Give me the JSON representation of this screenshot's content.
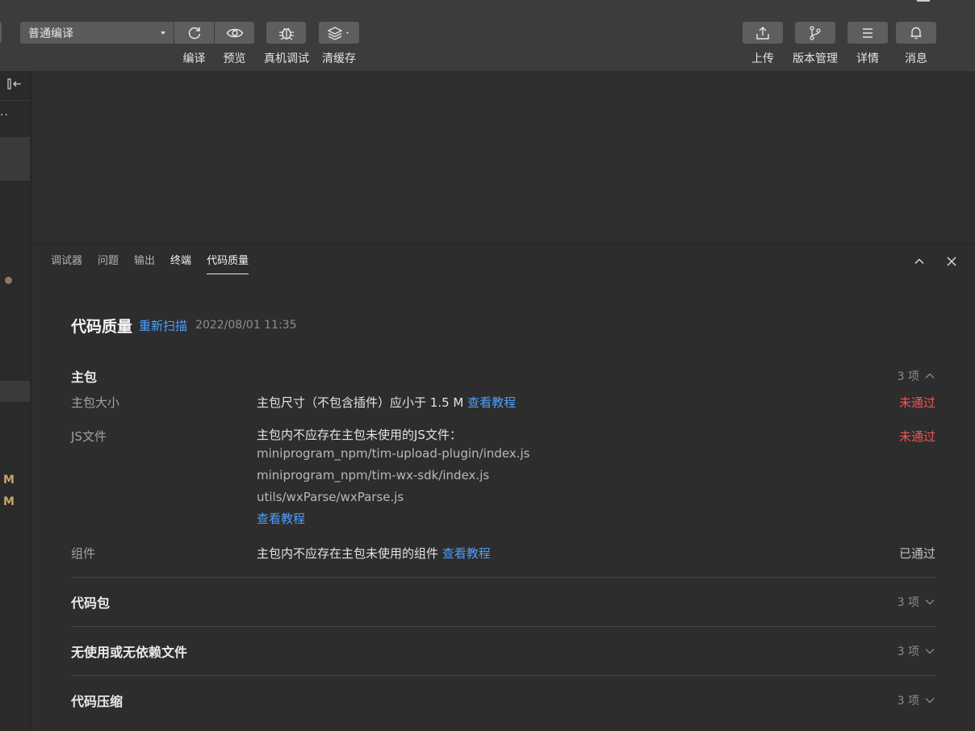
{
  "toolbar": {
    "compile_mode": "普通编译",
    "buttons": {
      "compile": "编译",
      "preview": "预览",
      "device_debug": "真机调试",
      "clear_cache": "清缓存",
      "upload": "上传",
      "version": "版本管理",
      "details": "详情",
      "messages": "消息"
    }
  },
  "left_strip": {
    "more_glyph": "··",
    "modified_badges": [
      "M",
      "M"
    ]
  },
  "panel": {
    "tabs": [
      "调试器",
      "问题",
      "输出",
      "终端",
      "代码质量"
    ],
    "active_tab": "代码质量"
  },
  "quality": {
    "title": "代码质量",
    "rescan": "重新扫描",
    "timestamp": "2022/08/01 11:35",
    "main_package": {
      "name": "主包",
      "count": "3 项",
      "rows": [
        {
          "label": "主包大小",
          "desc": "主包尺寸（不包含插件）应小于 1.5 M",
          "link": "查看教程",
          "status": "未通过"
        },
        {
          "label": "JS文件",
          "desc": "主包内不应存在主包未使用的JS文件：",
          "files": [
            "miniprogram_npm/tim-upload-plugin/index.js",
            "miniprogram_npm/tim-wx-sdk/index.js",
            "utils/wxParse/wxParse.js"
          ],
          "link": "查看教程",
          "status": "未通过"
        },
        {
          "label": "组件",
          "desc": "主包内不应存在主包未使用的组件",
          "link": "查看教程",
          "status": "已通过"
        }
      ]
    },
    "collapsed_sections": [
      {
        "name": "代码包",
        "count": "3 项"
      },
      {
        "name": "无使用或无依赖文件",
        "count": "3 项"
      },
      {
        "name": "代码压缩",
        "count": "3 项"
      }
    ]
  },
  "colors": {
    "link": "#4e9fff",
    "fail": "#f05555",
    "background": "#2c2c2c",
    "toolbar": "#3c3c3c"
  },
  "icons": {
    "compile": "refresh-icon",
    "preview": "eye-icon",
    "device_debug": "bug-icon",
    "clear_cache": "layers-icon",
    "upload": "upload-icon",
    "version": "branch-icon",
    "details": "menu-icon",
    "messages": "bell-icon"
  }
}
